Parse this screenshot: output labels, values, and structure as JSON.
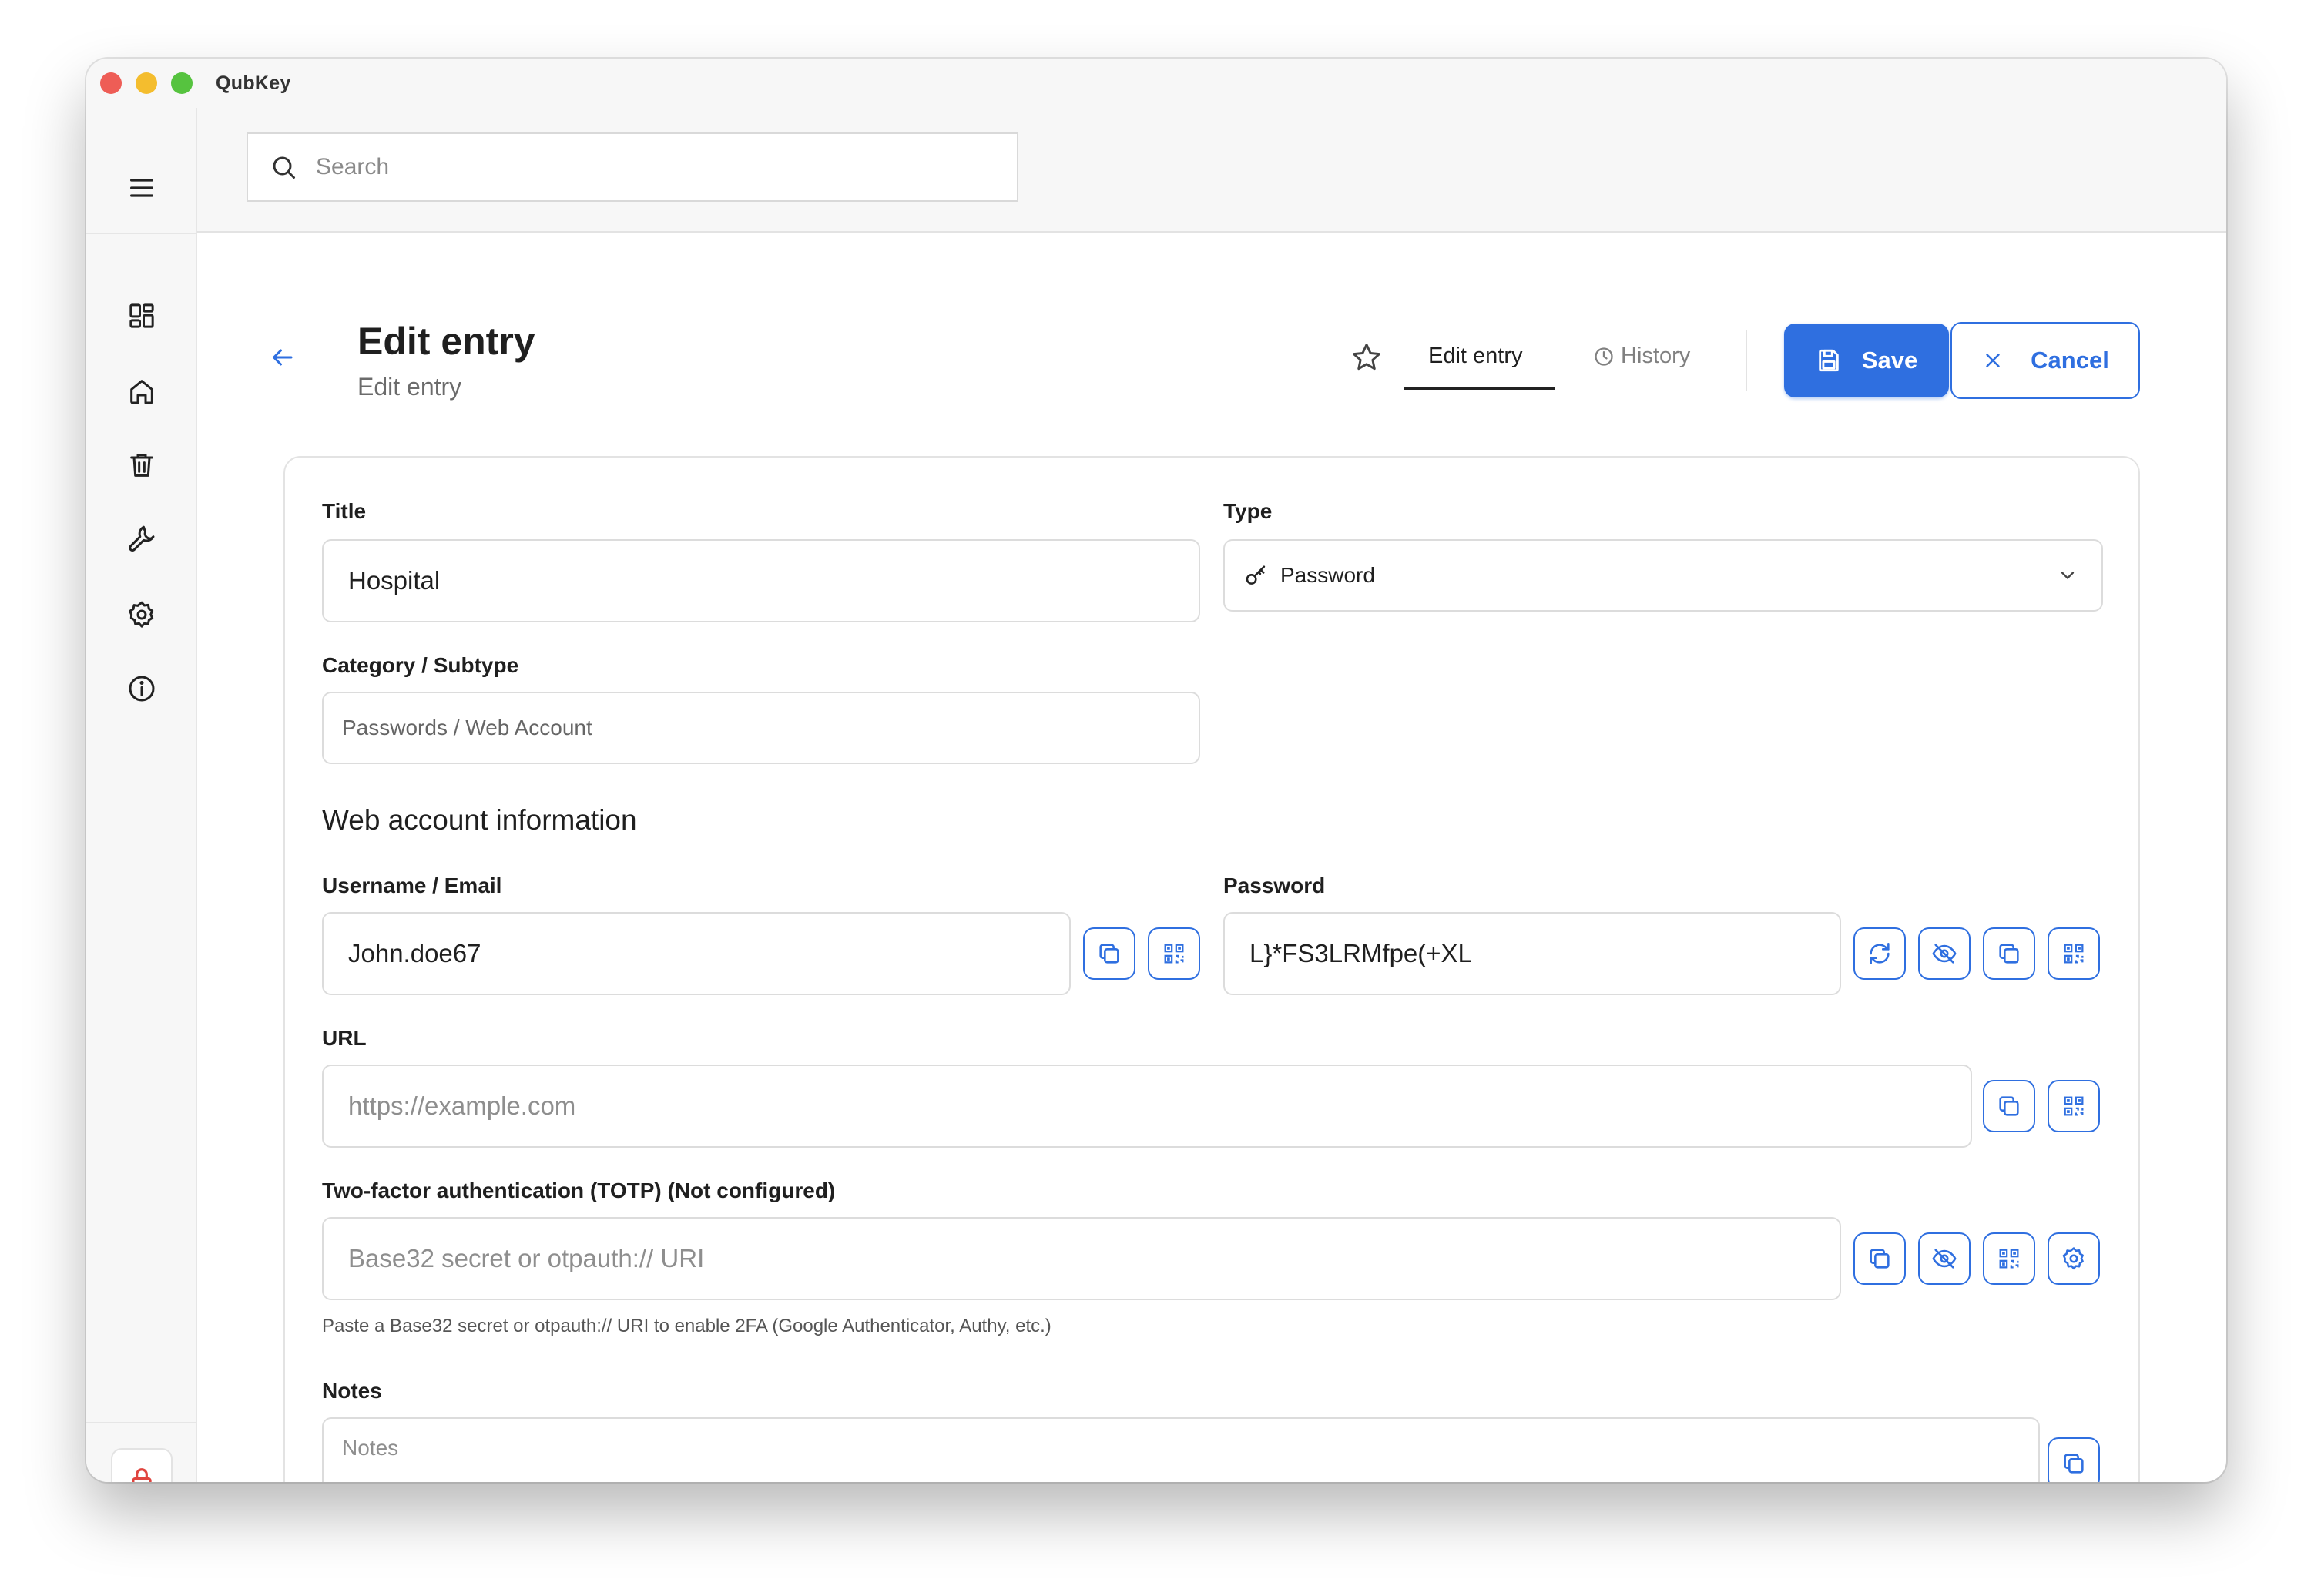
{
  "app": {
    "title": "QubKey"
  },
  "search": {
    "placeholder": "Search"
  },
  "header": {
    "title": "Edit entry",
    "subtitle": "Edit entry",
    "tabs": {
      "edit": "Edit entry",
      "history": "History"
    },
    "save_label": "Save",
    "cancel_label": "Cancel"
  },
  "form": {
    "title": {
      "label": "Title",
      "value": "Hospital"
    },
    "type": {
      "label": "Type",
      "value": "Password"
    },
    "category": {
      "label": "Category / Subtype",
      "value": "Passwords / Web Account"
    },
    "section_title": "Web account information",
    "username": {
      "label": "Username / Email",
      "value": "John.doe67"
    },
    "password": {
      "label": "Password",
      "value": "L}*FS3LRMfpe(+XL"
    },
    "url": {
      "label": "URL",
      "placeholder": "https://example.com"
    },
    "totp": {
      "label": "Two-factor authentication (TOTP) (Not configured)",
      "placeholder": "Base32 secret or otpauth:// URI",
      "help": "Paste a Base32 secret or otpauth:// URI to enable 2FA (Google Authenticator, Authy, etc.)"
    },
    "notes": {
      "label": "Notes",
      "placeholder": "Notes"
    }
  },
  "colors": {
    "accent": "#2f6fe0",
    "lock_icon": "#e0443e"
  }
}
